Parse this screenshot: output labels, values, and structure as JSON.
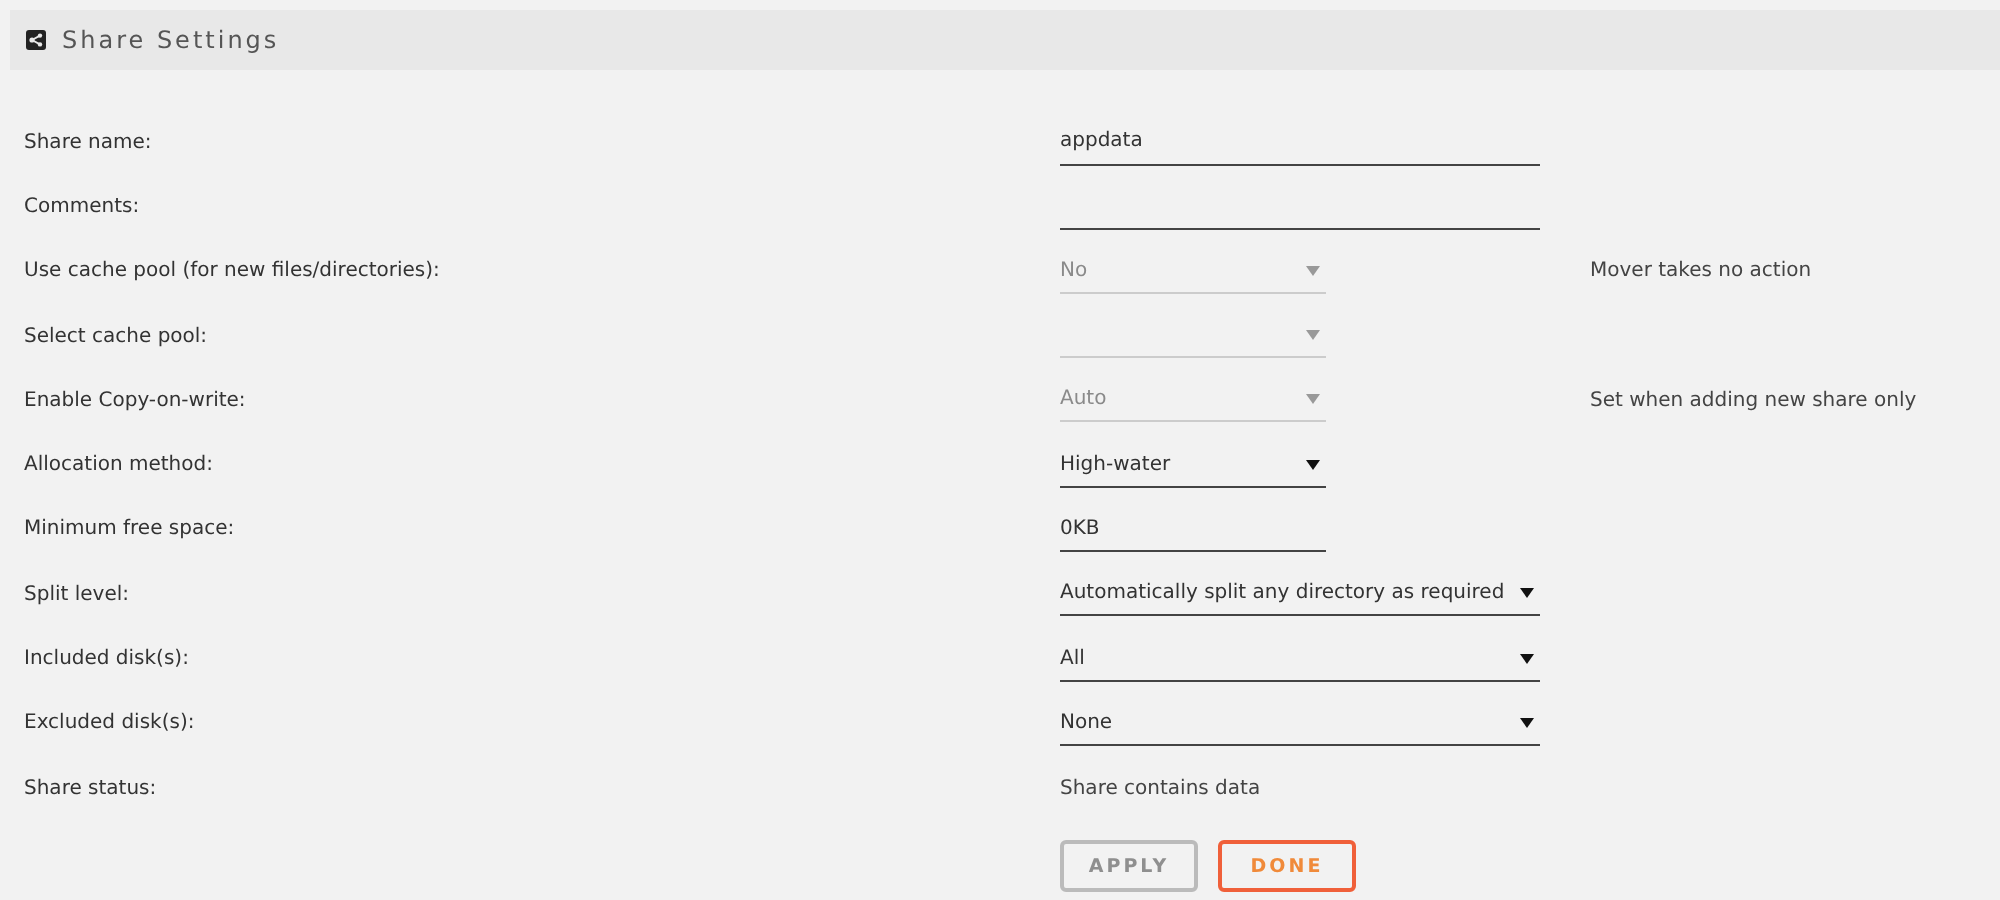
{
  "header": {
    "title": "Share Settings"
  },
  "fields": [
    {
      "label": "Share name:",
      "kind": "textbox",
      "value": "appdata"
    },
    {
      "label": "Comments:",
      "kind": "textbox"
    },
    {
      "label": "Use cache pool (for new files/directories):",
      "kind": "shortdropdown",
      "value": "No",
      "disabled": true,
      "note": "Mover takes no action"
    },
    {
      "label": "Select cache pool:",
      "kind": "shortdropdown",
      "disabled": true
    },
    {
      "label": "Enable Copy-on-write:",
      "kind": "shortdropdown",
      "value": "Auto",
      "disabled": true,
      "note": "Set when adding new share only"
    },
    {
      "label": "Allocation method:",
      "kind": "shortdropdown",
      "value": "High-water",
      "disabled": false
    },
    {
      "label": "Minimum free space:",
      "kind": "shorttextbox",
      "value": "0KB"
    },
    {
      "label": "Split level:",
      "kind": "dropdown",
      "value": "Automatically split any directory as required",
      "disabled": false
    },
    {
      "label": "Included disk(s):",
      "kind": "dropdown",
      "value": "All",
      "disabled": false
    },
    {
      "label": "Excluded disk(s):",
      "kind": "dropdown",
      "value": "None",
      "disabled": false
    },
    {
      "label": "Share status:",
      "kind": "static",
      "value": "Share contains data"
    }
  ],
  "buttons": [
    {
      "label": "APPLY",
      "disabled": true
    },
    {
      "label": "DONE",
      "disabled": false
    }
  ]
}
